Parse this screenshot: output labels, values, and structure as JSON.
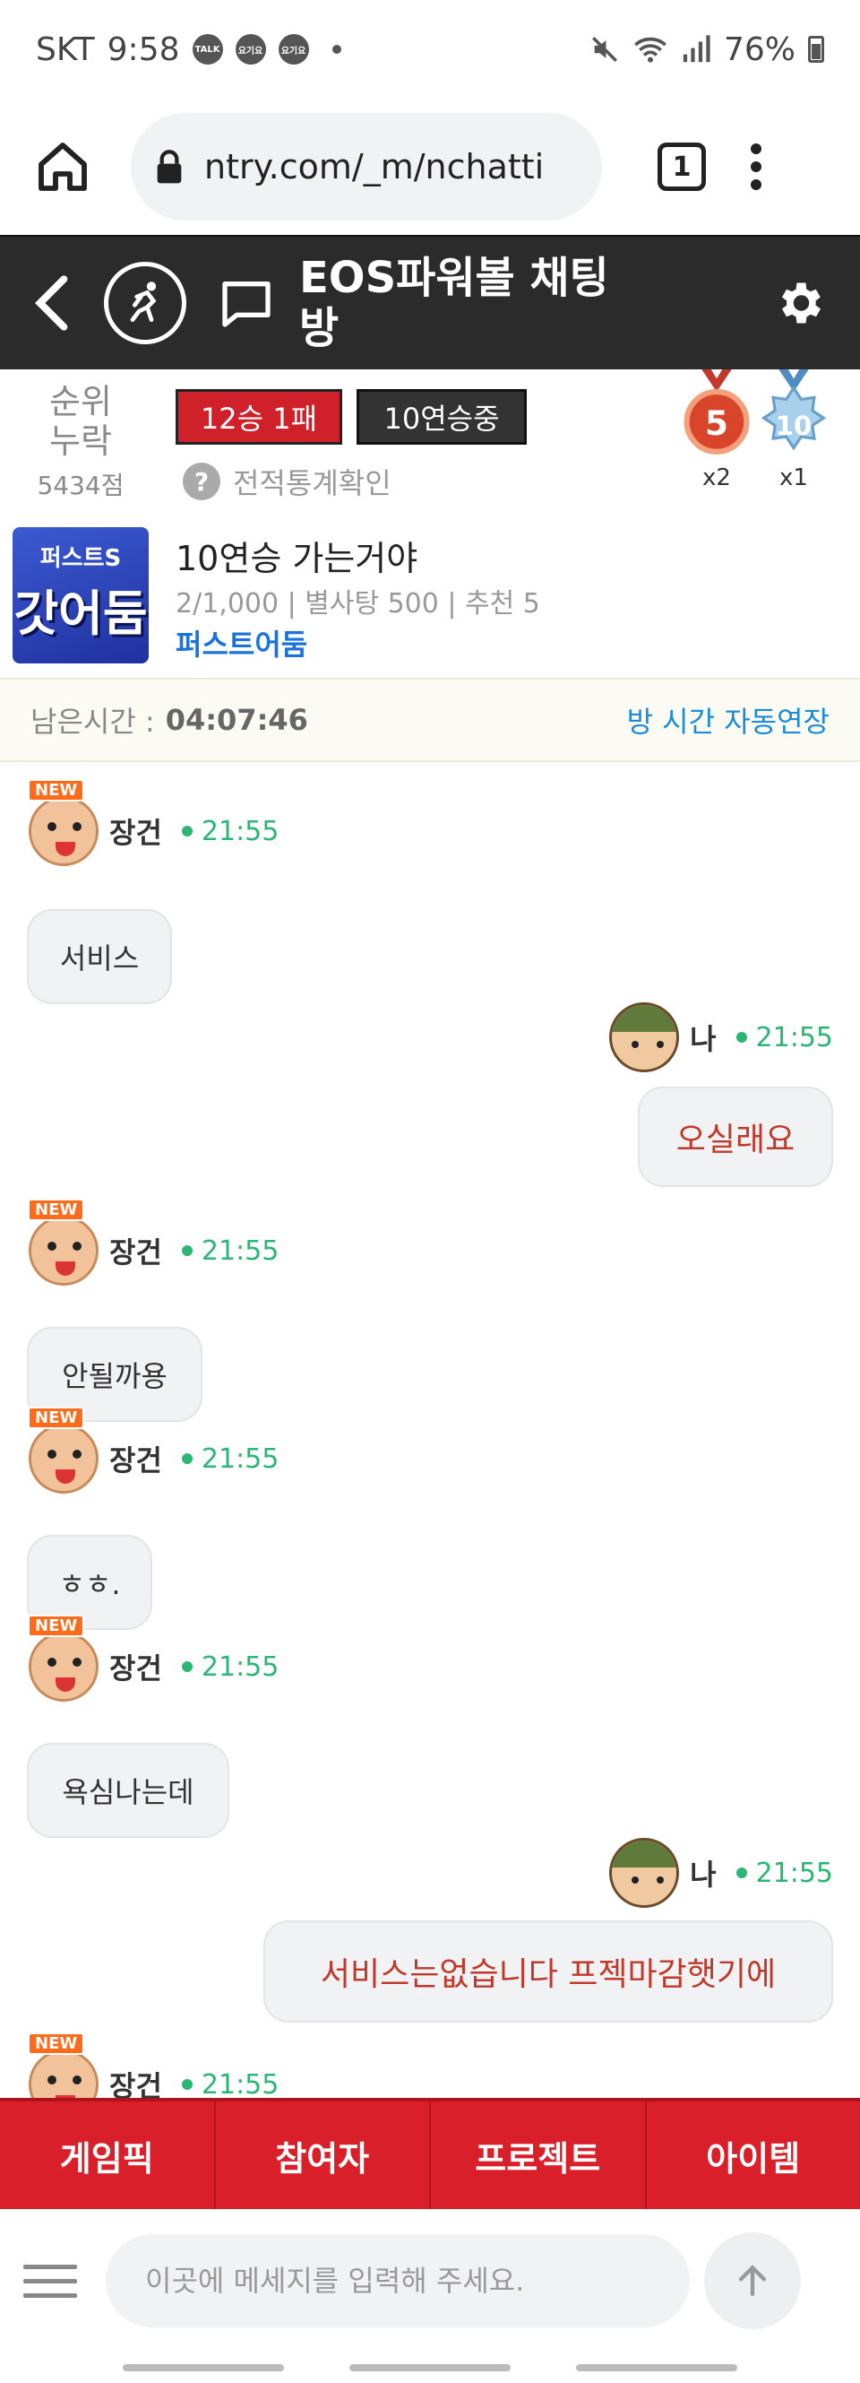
{
  "status_bar": {
    "carrier": "SKT",
    "time": "9:58",
    "notifications": [
      "TALK",
      "요기요",
      "요기요"
    ],
    "battery": "76%"
  },
  "browser": {
    "url": "ntry.com/_m/nchatti",
    "tab_count": "1"
  },
  "header": {
    "title": "EOS파워볼 채팅방"
  },
  "profile": {
    "rank_line1": "순위",
    "rank_line2": "누락",
    "points": "5434점",
    "record": "12승 1패",
    "streak": "10연승중",
    "stats_link": "전적통계확인",
    "medals": [
      {
        "value": "5",
        "count": "x2",
        "color": "#d8452a"
      },
      {
        "value": "10",
        "count": "x1",
        "color": "#7fb3d8"
      }
    ]
  },
  "room": {
    "thumb_line1": "퍼스트S",
    "thumb_line2": "갓어둠",
    "title": "10연승 가는거야",
    "meta": "2/1,000 | 별사탕 500 | 추천 5",
    "owner": "퍼스트어둠"
  },
  "timer": {
    "label": "남은시간 :",
    "value": "04:07:46",
    "extend": "방 시간 자동연장"
  },
  "chat": {
    "new_tag": "NEW",
    "messages": [
      {
        "sender": "장건",
        "time": "21:55",
        "text": "서비스",
        "mine": false
      },
      {
        "sender": "나",
        "time": "21:55",
        "text": "오실래요",
        "mine": true
      },
      {
        "sender": "장건",
        "time": "21:55",
        "text": "안될까용",
        "mine": false
      },
      {
        "sender": "장건",
        "time": "21:55",
        "text": "ㅎㅎ.",
        "mine": false
      },
      {
        "sender": "장건",
        "time": "21:55",
        "text": "욕심나는데",
        "mine": false
      },
      {
        "sender": "나",
        "time": "21:55",
        "text": "서비스는없습니다 프젝마감햇기에",
        "mine": true
      },
      {
        "sender": "장건",
        "time": "21:55",
        "text": "",
        "mine": false
      }
    ]
  },
  "tabs": [
    "게임픽",
    "참여자",
    "프로젝트",
    "아이템"
  ],
  "input": {
    "placeholder": "이곳에 메세지를 입력해 주세요."
  },
  "colors": {
    "accent_red": "#d81f2a",
    "header_dark": "#2b2b2b",
    "online_green": "#2bb673",
    "link_blue": "#1a73d9",
    "my_message_text": "#c0392b"
  }
}
